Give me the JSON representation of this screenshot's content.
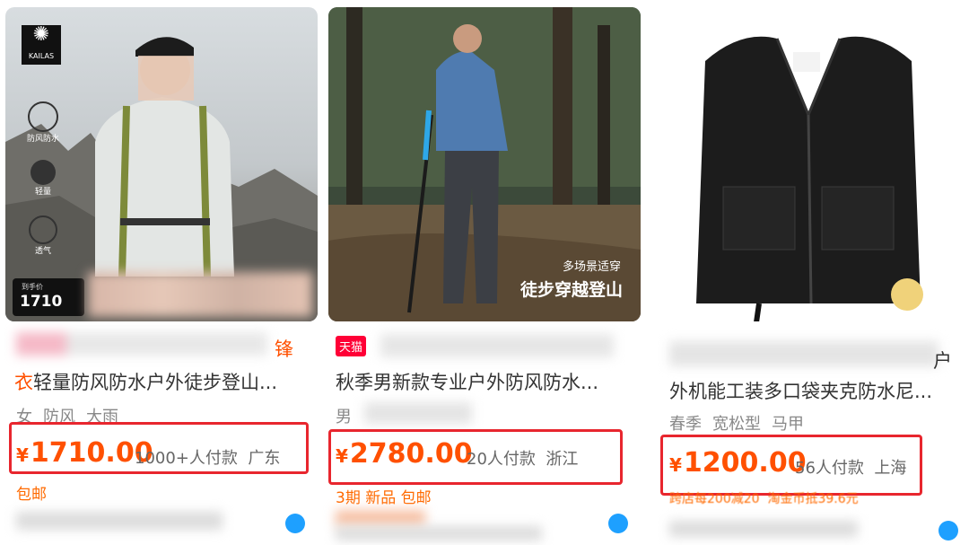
{
  "products": [
    {
      "logo_text": "KAILAS",
      "feature_labels": [
        "防风防水",
        "轻量",
        "透气"
      ],
      "price_badge_label": "到手价",
      "price_badge_value": "1710",
      "title_line1_suffix": "锋",
      "title_line2_highlight": "衣",
      "title_line2_rest": "轻量防风防水户外徒步登山...",
      "tags": [
        "女",
        "防风",
        "大雨"
      ],
      "price_symbol": "¥",
      "price": "1710.00",
      "sales": "1000+人付款",
      "location": "广东",
      "badges": [
        "包邮"
      ]
    },
    {
      "tmall_badge": "天猫",
      "overlay_small": "多场景适穿",
      "overlay_large": "徒步穿越登山",
      "title_line2": "秋季男新款专业户外防风防水...",
      "tags": [
        "男"
      ],
      "price_symbol": "¥",
      "price": "2780.00",
      "sales": "20人付款",
      "location": "浙江",
      "badges": [
        "3期",
        "新品",
        "包邮"
      ]
    },
    {
      "title_line1_suffix": "户",
      "title_line2": "外机能工装多口袋夹克防水尼...",
      "tags": [
        "春季",
        "宽松型",
        "马甲"
      ],
      "price_symbol": "¥",
      "price": "1200.00",
      "sales": "56人付款",
      "location": "上海",
      "badges": [
        "跨店每200减20",
        "淘金币抵39.6元"
      ]
    }
  ]
}
